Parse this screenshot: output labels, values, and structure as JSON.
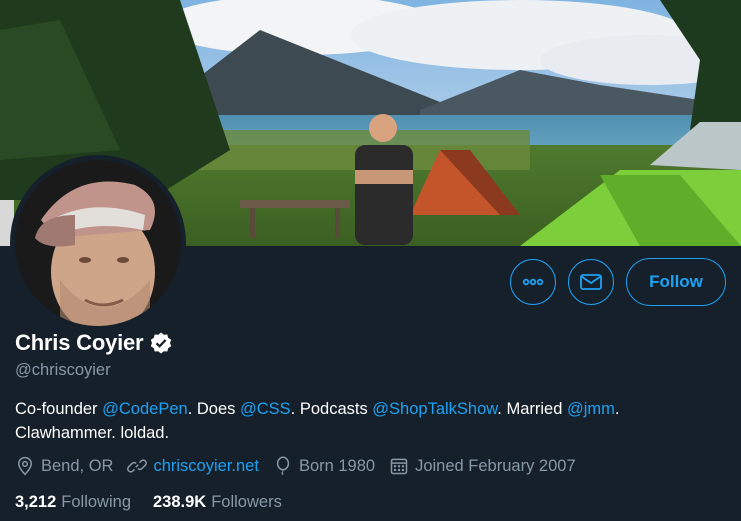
{
  "profile": {
    "name": "Chris Coyier",
    "handle": "@chriscoyier",
    "verified": true
  },
  "actions": {
    "more_icon": "more-icon",
    "message_icon": "envelope-icon",
    "follow_label": "Follow"
  },
  "bio": {
    "t1": "Co-founder ",
    "link1": "@CodePen",
    "t2": ". Does ",
    "link2": "@CSS",
    "t3": ". Podcasts ",
    "link3": "@ShopTalkShow",
    "t4": ". Married ",
    "link4": "@jmm",
    "t5": ". Clawhammer. loldad."
  },
  "meta": {
    "location": "Bend, OR",
    "website": "chriscoyier.net",
    "born": "Born 1980",
    "joined": "Joined February 2007"
  },
  "counts": {
    "following_num": "3,212",
    "following_label": "Following",
    "followers_num": "238.9K",
    "followers_label": "Followers"
  },
  "colors": {
    "background": "#15202b",
    "accent": "#1da1f2",
    "secondary_text": "#8899a6"
  }
}
